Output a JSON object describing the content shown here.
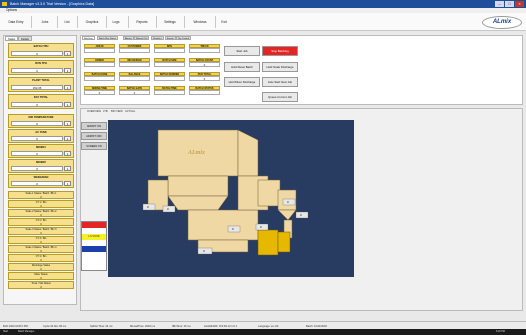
{
  "window": {
    "title": "Batch Manager v3.3.0 Trial Version - [Graphics Data]"
  },
  "menubar": {
    "options": "Options"
  },
  "toolbar": {
    "items": [
      "Data Entry",
      "Jobs",
      "List",
      "Graphics",
      "Logs",
      "Reports",
      "Settings",
      "Windows",
      "Exit"
    ],
    "logo": "ALmix"
  },
  "left_panel": {
    "tabs": [
      "Status",
      "Details"
    ],
    "cards": [
      {
        "label": "BATCH TPH",
        "value": "0",
        "btn": "1"
      },
      {
        "label": "RUN TPH",
        "value": "0",
        "btn": "1"
      },
      {
        "label": "PLANT TOTAL",
        "value": "152.35",
        "btn": "1"
      },
      {
        "label": "DAY TOTAL",
        "value": "0",
        "btn": "1"
      },
      {
        "label": "MIX TEMPERATURE",
        "value": "0",
        "btn": "1"
      },
      {
        "label": "AC TANK",
        "value": "0",
        "btn": "1"
      },
      {
        "label": "MIXER1",
        "value": "0",
        "btn": "1"
      },
      {
        "label": "MIXER2",
        "value": "0",
        "btn": "1"
      },
      {
        "label": "WEIGHMAN",
        "value": "0",
        "btn": "1"
      }
    ],
    "stats": [
      {
        "label": "Scale 1 Status / Batch / Bin 1",
        "value": "0"
      },
      {
        "label": "CT 1 / Bin",
        "value": "0"
      },
      {
        "label": "Scale 2 Status / Batch / Bin 2",
        "value": "0"
      },
      {
        "label": "CT 2 / Bin",
        "value": "0"
      },
      {
        "label": "Scale 3 Status / Batch / Bin 3",
        "value": "0"
      },
      {
        "label": "CT 3 / Bin",
        "value": "0"
      },
      {
        "label": "Scale 4 Status / Batch / Bin 4",
        "value": "0"
      },
      {
        "label": "CT 4 / Bin",
        "value": "0"
      },
      {
        "label": "Discharge Status",
        "value": "0"
      },
      {
        "label": "Mixer Status",
        "value": "0"
      },
      {
        "label": "Truck / Silo Status",
        "value": "0"
      }
    ]
  },
  "job_area": {
    "tabs": [
      "Batching",
      "Batch Run Status",
      "Alarms",
      "Manual Ctrl",
      "Statistics",
      "Events",
      "Dry Control"
    ],
    "row1_labels": [
      "JOB ID",
      "CUSTOMER",
      "SITE",
      "TRUCK"
    ],
    "row2_labels": [
      "ORDER",
      "MIX DESIGN",
      "BATCH SIZE",
      "BATCH COUNT"
    ],
    "row3_labels": [
      "BATCH DONE",
      "BALANCE",
      "BATCH NUMBER",
      "PUR TOTAL"
    ],
    "row4_labels": [
      "MIXING TIME",
      "BATCH GATE",
      "BATCH TIME",
      "BATCH STATUS"
    ],
    "values": [
      "0",
      "0",
      "0",
      "0"
    ],
    "actions": {
      "start": "Start Job",
      "stop": "Stop Batching",
      "hold_reset": "Hold Reset Batch",
      "hold_scale": "Hold Scale Discharge",
      "hold_mixer": "Hold Mixer Discharge",
      "auto_start": "Auto Start Next Job",
      "queue": "Queue Current Job"
    }
  },
  "view_area": {
    "tabs": [
      "OVERVIEW",
      "LTB",
      "BIN VIEW",
      "ACTUAL"
    ],
    "left_buttons": [
      "ADMIXT ON",
      "ADMIXT OFF",
      "SCREEN ON"
    ],
    "right_buttons": [
      "BATCH AUTO",
      "HOLD BATCH",
      "HOLD SCALE",
      "HOLD MIXER"
    ],
    "legend_yellow": "LO STATE",
    "machine_logo": "ALmix",
    "values": [
      "0",
      "0",
      "0",
      "0",
      "0",
      "0",
      "0"
    ]
  },
  "status_bar": {
    "items": [
      "BLD:1000.0/2017.PM",
      "Cycle:44 Nov 06 ms",
      "SpDist:Time: 24 ms",
      "MLoadTime: 2049 ms",
      "IBinTime: 15 ms",
      "AutoMiniRF: 972.84.12.1.0.1",
      "Language: en-US",
      "Batch: 10/11/2018"
    ]
  },
  "taskbar": {
    "items": [
      "Start",
      "Batch Manager...",
      "6:20 PM"
    ]
  },
  "colors": {
    "title_bar": "#1f4e9a",
    "card": "#f6e08d",
    "stop": "#e32525",
    "machine_bg": "#283c62"
  }
}
